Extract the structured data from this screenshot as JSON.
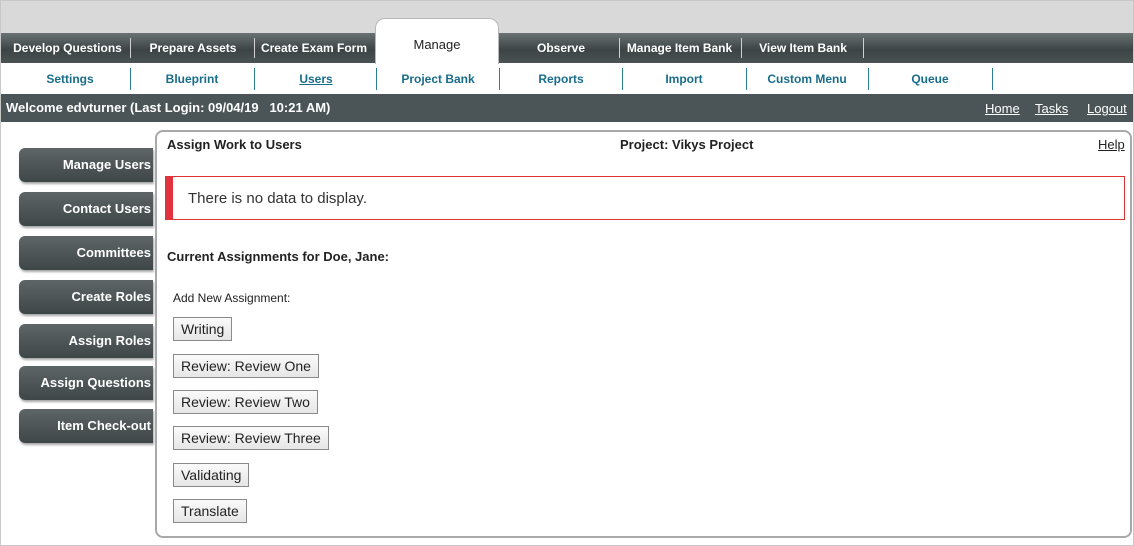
{
  "main_tabs": [
    {
      "label": "Develop Questions"
    },
    {
      "label": "Prepare Assets"
    },
    {
      "label": "Create Exam Form"
    },
    {
      "label": "Manage"
    },
    {
      "label": "Observe"
    },
    {
      "label": "Manage Item Bank"
    },
    {
      "label": "View Item Bank"
    }
  ],
  "sub_tabs": [
    {
      "label": "Settings"
    },
    {
      "label": "Blueprint"
    },
    {
      "label": "Users"
    },
    {
      "label": "Project Bank"
    },
    {
      "label": "Reports"
    },
    {
      "label": "Import"
    },
    {
      "label": "Custom Menu"
    },
    {
      "label": "Queue"
    }
  ],
  "welcome": {
    "text": "Welcome edvturner (Last Login: 09/04/19   10:21 AM)",
    "links": {
      "home": "Home",
      "tasks": "Tasks",
      "logout": "Logout"
    }
  },
  "sidebar": [
    {
      "label": "Manage Users"
    },
    {
      "label": "Contact Users"
    },
    {
      "label": "Committees"
    },
    {
      "label": "Create Roles"
    },
    {
      "label": "Assign Roles"
    },
    {
      "label": "Assign Questions"
    },
    {
      "label": "Item Check-out"
    }
  ],
  "panel": {
    "title": "Assign Work to Users",
    "project": "Project: Vikys Project",
    "help": "Help",
    "alert": "There is no data to display.",
    "current": "Current Assignments for Doe, Jane:",
    "add_new": "Add New Assignment:",
    "buttons": [
      {
        "label": "Writing"
      },
      {
        "label": "Review: Review One"
      },
      {
        "label": "Review: Review Two"
      },
      {
        "label": "Review: Review Three"
      },
      {
        "label": "Validating"
      },
      {
        "label": "Translate"
      }
    ]
  },
  "colors": {
    "nav_dark": "#3c4446",
    "sub_link": "#1a6d8a",
    "alert_accent": "#e0333f"
  }
}
